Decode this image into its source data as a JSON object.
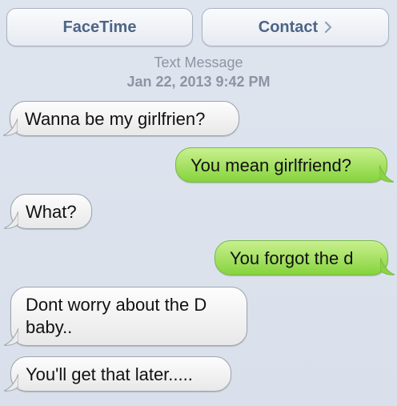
{
  "buttons": {
    "facetime": "FaceTime",
    "contact": "Contact"
  },
  "meta": {
    "kind": "Text Message",
    "date": "Jan 22, 2013 9:42 PM"
  },
  "messages": [
    {
      "side": "incoming",
      "text": "Wanna be my girlfrien?"
    },
    {
      "side": "outgoing",
      "text": "You mean girlfriend?"
    },
    {
      "side": "incoming",
      "text": "What?"
    },
    {
      "side": "outgoing",
      "text": "You forgot the d"
    },
    {
      "side": "incoming",
      "text": "Dont worry about the D baby.."
    },
    {
      "side": "incoming",
      "text": "You'll get that later....."
    }
  ],
  "colors": {
    "background": "#dbe2ed",
    "incoming": "#f2f2f2",
    "outgoing": "#9fdd5c",
    "button_text": "#4c6587",
    "meta_text": "#8c95a3"
  },
  "icons": {
    "contact_chevron": "chevron-right-icon"
  }
}
